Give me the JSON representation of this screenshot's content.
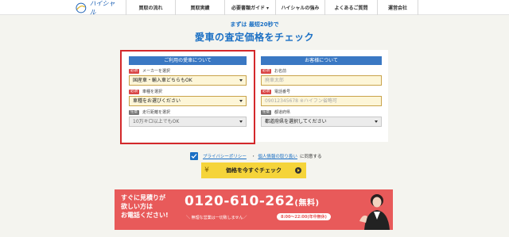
{
  "header": {
    "logo_text": "ハイシャル",
    "nav": [
      {
        "label": "買取の流れ"
      },
      {
        "label": "買取実績"
      },
      {
        "label": "必要書類ガイド ▾"
      },
      {
        "label": "ハイシャルの強み"
      },
      {
        "label": "よくあるご質問"
      },
      {
        "label": "運営会社"
      }
    ]
  },
  "hero": {
    "subhead": "まずは 最短20秒で",
    "headline": "愛車の査定価格をチェック"
  },
  "form": {
    "left": {
      "heading": "ご利用の愛車について",
      "fields": [
        {
          "badge": "必須",
          "label": "メーカーを選択",
          "value": "国産車・輸入車どちらもOK"
        },
        {
          "badge": "必須",
          "label": "車種を選択",
          "value": "車種をお選びください"
        },
        {
          "badge": "任意",
          "label": "走行距離を選択",
          "value": "10万キロ以上でもOK"
        }
      ]
    },
    "right": {
      "heading": "お客様について",
      "fields": [
        {
          "badge": "必須",
          "label": "お名前",
          "placeholder": "廃車太郎"
        },
        {
          "badge": "必須",
          "label": "電話番号",
          "placeholder": "09012345678 ※ハイフン省略可"
        },
        {
          "badge": "任意",
          "label": "都道府県",
          "value": "都道府県を選択してください"
        }
      ]
    }
  },
  "privacy": {
    "link1": "プライバシーポリシー",
    "sep": "・",
    "link2": "個人情報の取り扱い",
    "suffix": "に同意する"
  },
  "cta": {
    "icon": "¥",
    "label": "価格を今すぐチェック"
  },
  "banner": {
    "line1": "すぐに見積りが",
    "line2": "欲しい方は",
    "line3": "お電話ください!",
    "number": "0120-610-262",
    "free": "(無料)",
    "note": "＼ 無理な営業は一切致しません／",
    "hours": "8:00〜22:00(年中無休)"
  },
  "colors": {
    "primary": "#1a6fc4",
    "accent": "#f5d43a",
    "banner": "#e85a5a",
    "highlight_frame": "#d3282b"
  }
}
